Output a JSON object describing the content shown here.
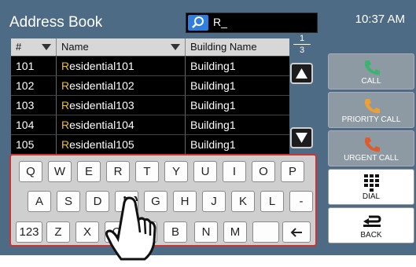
{
  "header": {
    "title": "Address Book",
    "search_value": "R_",
    "clock": "10:37 AM"
  },
  "table": {
    "columns": [
      "#",
      "Name",
      "Building Name"
    ],
    "rows": [
      {
        "num": "101",
        "name_hl": "R",
        "name_rest": "esidential101",
        "building": "Building1"
      },
      {
        "num": "102",
        "name_hl": "R",
        "name_rest": "esidential102",
        "building": "Building1"
      },
      {
        "num": "103",
        "name_hl": "R",
        "name_rest": "esidential103",
        "building": "Building1"
      },
      {
        "num": "104",
        "name_hl": "R",
        "name_rest": "esidential104",
        "building": "Building1"
      },
      {
        "num": "105",
        "name_hl": "R",
        "name_rest": "esidential105",
        "building": "Building1"
      }
    ]
  },
  "pager": {
    "current": "1",
    "total": "3"
  },
  "keyboard": {
    "row1": [
      "Q",
      "W",
      "E",
      "R",
      "T",
      "Y",
      "U",
      "I",
      "O",
      "P"
    ],
    "row2": [
      "A",
      "S",
      "D",
      "F",
      "G",
      "H",
      "J",
      "K",
      "L",
      "-"
    ],
    "row3": [
      "123",
      "Z",
      "X",
      "C",
      "V",
      "B",
      "N",
      "M",
      "",
      ""
    ]
  },
  "side_buttons": {
    "call": "CALL",
    "priority": "PRIORITY CALL",
    "urgent": "URGENT CALL",
    "dial": "DIAL",
    "back": "BACK"
  },
  "colors": {
    "background": "#4e6b86",
    "highlight": "#f2c319",
    "call_green": "#3cb371",
    "priority_orange": "#f0a030",
    "urgent_red": "#e05a2a"
  }
}
